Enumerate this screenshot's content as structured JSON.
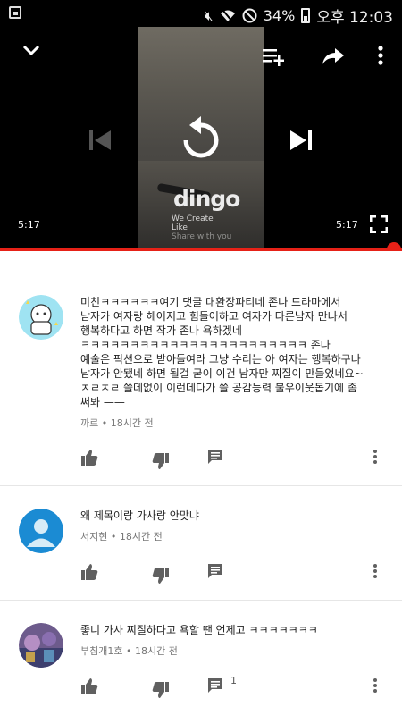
{
  "status_bar": {
    "icons": [
      "image-icon",
      "mute-icon",
      "wifi-icon",
      "no-disturb-icon"
    ],
    "battery": "34%",
    "time": "오후 12:03"
  },
  "player": {
    "watermark": "dingo",
    "watermark_sub": [
      "We Create",
      "Like",
      "Share with you"
    ],
    "time_left": "5:17",
    "time_right": "5:17",
    "progress": 0.98,
    "accent_color": "#e62117"
  },
  "comments": [
    {
      "text": "미친ㅋㅋㅋㅋㅋㅋ여기 댓글 대환장파티네 존나 드라마에서\n남자가 여자랑 헤어지고 힘들어하고 여자가 다른남자 만나서\n행복하다고 하면 작가 존나 욕하겠네\nㅋㅋㅋㅋㅋㅋㅋㅋㅋㅋㅋㅋㅋㅋㅋㅋㅋㅋㅋㅋㅋㅋㅋ 존나\n예술은 픽션으로 받아들여라 그냥 수리는 아 여자는 행복하구나\n남자가 안됐네 하면 될걸 굳이 이건 남자만 찌질이 만들었네요~\nㅈㄹㅈㄹ 쓸데없이 이런데다가 쓸 공감능력 불우이웃돕기에 좀\n써봐 ——",
      "author": "까르",
      "time": "18시간 전",
      "reply_count": ""
    },
    {
      "text": "왜 제목이랑 가사랑 안맞냐",
      "author": "서지현",
      "time": "18시간 전",
      "reply_count": ""
    },
    {
      "text": "좋니 가사 찌질하다고 욕할 땐 언제고 ㅋㅋㅋㅋㅋㅋㅋ",
      "author": "부침개1호",
      "time": "18시간 전",
      "reply_count": "1"
    }
  ]
}
